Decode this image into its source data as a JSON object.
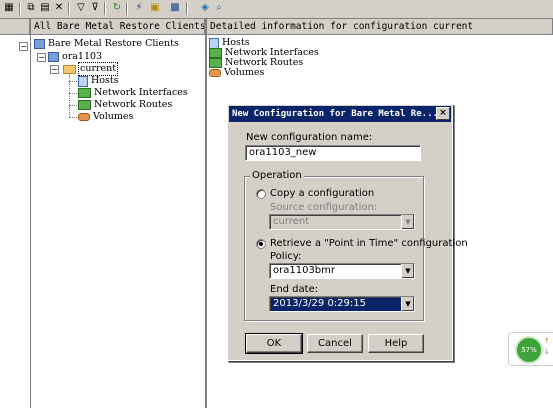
{
  "left_pane": {
    "header": "All Bare Metal Restore Clients for m",
    "tree": {
      "root": "Bare Metal Restore Clients",
      "client": "ora1103",
      "config": "current",
      "children": [
        "Hosts",
        "Network Interfaces",
        "Network Routes",
        "Volumes"
      ]
    }
  },
  "right_pane": {
    "header": "Detailed information for configuration current",
    "items": [
      "Hosts",
      "Network Interfaces",
      "Network Routes",
      "Volumes"
    ]
  },
  "dialog": {
    "title": "New Configuration for Bare Metal Re...",
    "close_glyph": "×",
    "name_label": "New configuration name:",
    "name_value": "ora1103_new",
    "operation_legend": "Operation",
    "copy_label": "Copy a configuration",
    "copy_selected": false,
    "source_label": "Source configuration:",
    "source_value": "current",
    "retrieve_label": "Retrieve a \"Point in Time\" configuration",
    "retrieve_selected": true,
    "policy_label": "Policy:",
    "policy_value": "ora1103bmr",
    "end_date_label": "End date:",
    "end_date_value": "2013/3/29 0:29:15",
    "ok_label": "OK",
    "cancel_label": "Cancel",
    "help_label": "Help"
  },
  "system_gauge": {
    "value_text": "57%",
    "up_glyph": "↑",
    "down_glyph": "↓"
  },
  "colors": {
    "title_bar": "#0a246a",
    "face": "#d4d0c8"
  }
}
